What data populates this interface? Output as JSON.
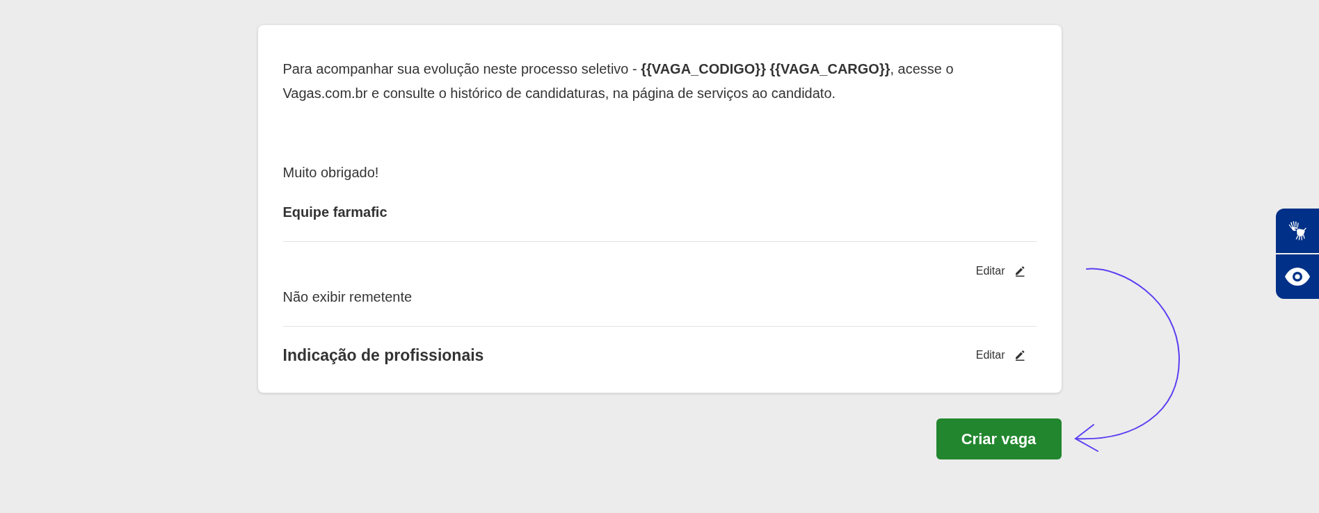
{
  "message": {
    "body": "Para acompanhar sua evolução neste processo seletivo - **{{VAGA_CODIGO}} {{VAGA_CARGO}}**, acesse o Vagas.com.br e consulte o histórico de candidaturas, na página de serviços ao candidato.",
    "closing": "Muito obrigado!",
    "signature": "Equipe farmafic"
  },
  "sections": [
    {
      "kind": "setting",
      "value": "Não exibir remetente",
      "edit_label": "Editar"
    },
    {
      "kind": "heading",
      "title": "Indicação de profissionais",
      "edit_label": "Editar"
    }
  ],
  "primary_button": {
    "label": "Criar vaga"
  }
}
